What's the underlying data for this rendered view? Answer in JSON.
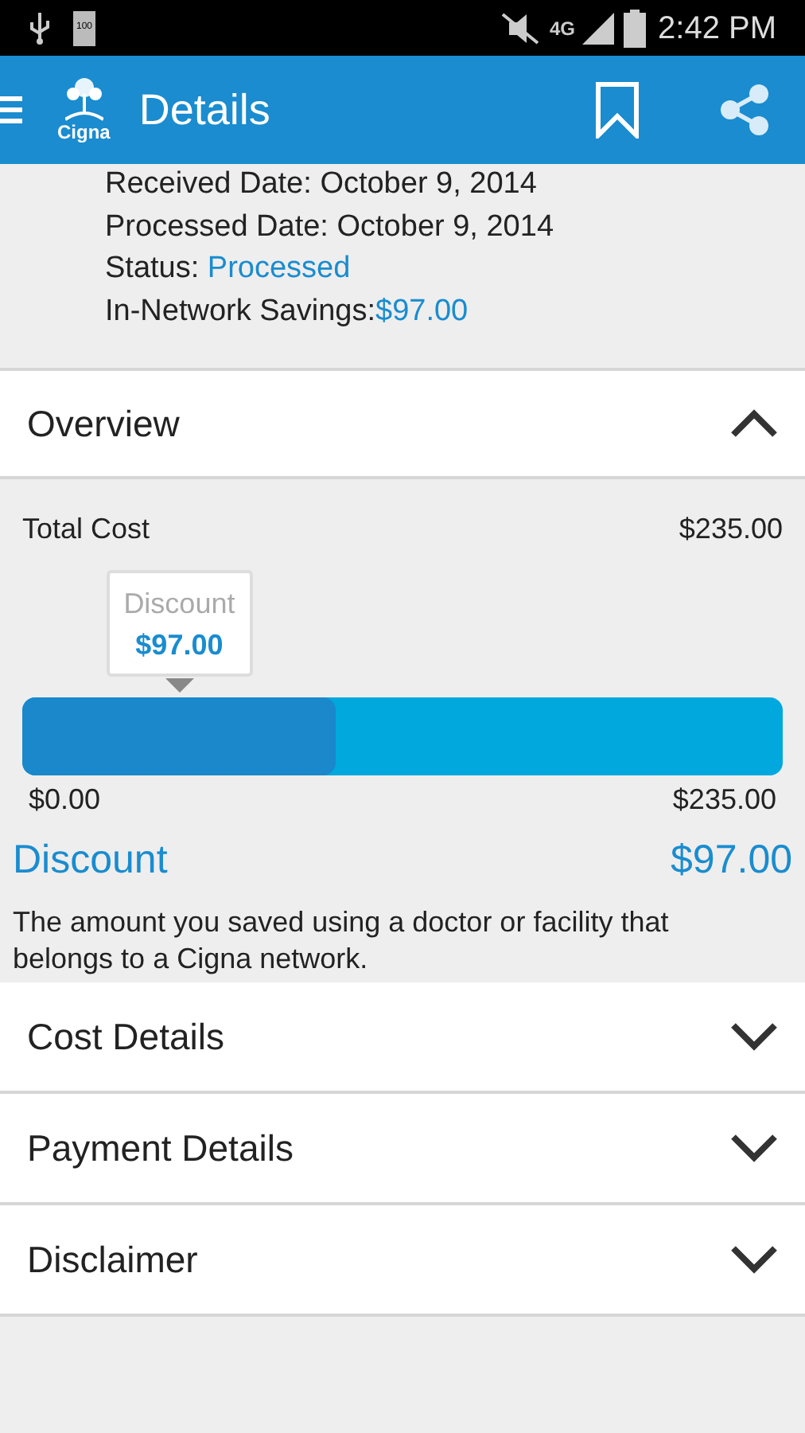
{
  "status_bar": {
    "battery_text": "100",
    "network": "4G",
    "time": "2:42 PM"
  },
  "app_bar": {
    "logo": "Cigna",
    "title": "Details"
  },
  "claim_info": [
    {
      "label": "Received Date: ",
      "value": "October 9, 2014",
      "highlight": false
    },
    {
      "label": "Processed Date: ",
      "value": "October 9, 2014",
      "highlight": false
    },
    {
      "label": "Status: ",
      "value": "Processed",
      "highlight": true
    },
    {
      "label": "In-Network Savings:",
      "value": "$97.00",
      "highlight": true
    }
  ],
  "overview": {
    "title": "Overview",
    "expanded": true,
    "total_label": "Total Cost",
    "total_value": "$235.00",
    "tooltip": {
      "label": "Discount",
      "value": "$97.00"
    },
    "level": 0.413,
    "min": "$0.00",
    "max": "$235.00",
    "discount_label": "Discount",
    "discount_value": "$97.00",
    "description": "The amount you saved using a doctor or facility that belongs to a Cigna network."
  },
  "sections": [
    {
      "title": "Cost Details",
      "expanded": false
    },
    {
      "title": "Payment Details",
      "expanded": false
    },
    {
      "title": "Disclaimer",
      "expanded": false
    }
  ]
}
